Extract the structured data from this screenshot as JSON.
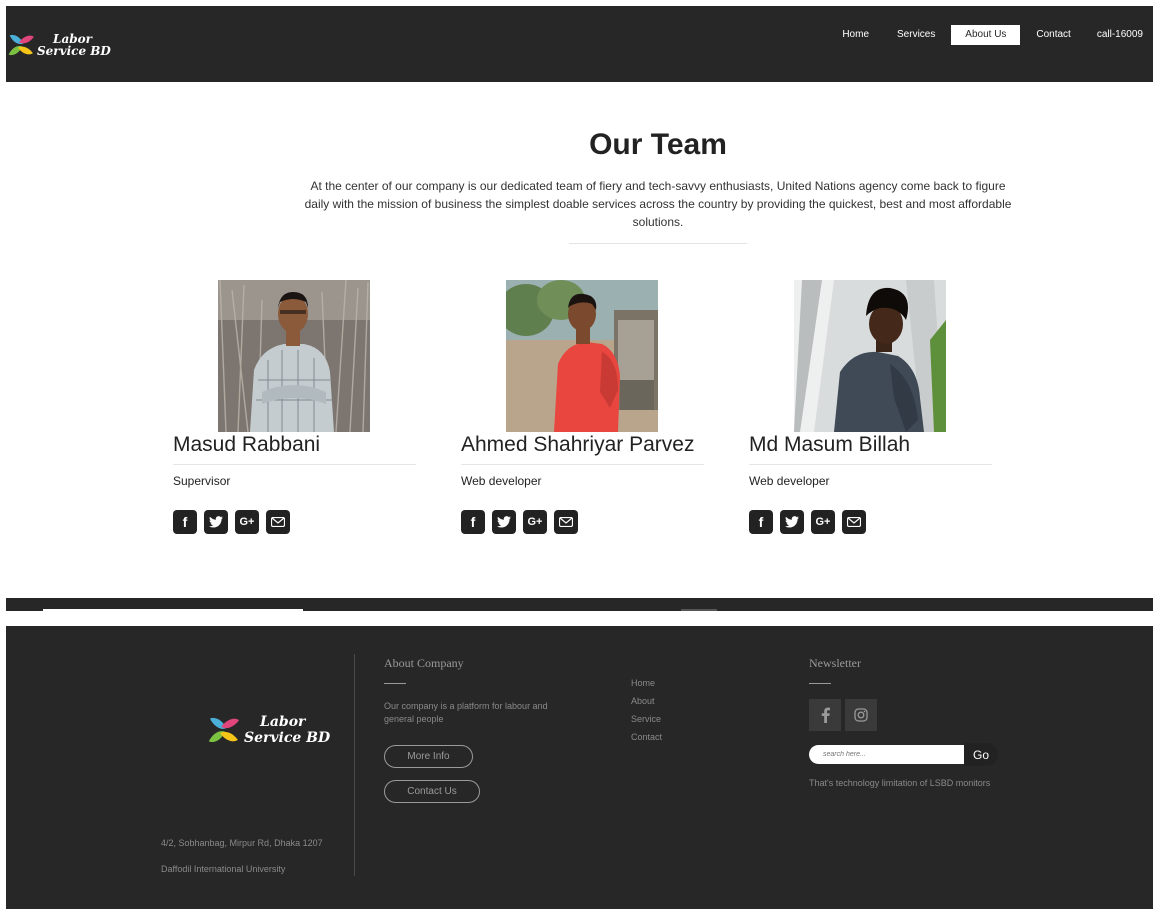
{
  "nav": {
    "logo_line1": "Labor",
    "logo_line2": "Service BD",
    "links": [
      "Home",
      "Services",
      "About Us",
      "Contact",
      "call-16009"
    ]
  },
  "team": {
    "title": "Our Team",
    "description": "At the center of our company is our dedicated team of fiery and tech-savvy enthusiasts, United Nations agency come back to figure daily with the mission of business the simplest doable services across the country by providing the quickest, best and most affordable solutions.",
    "members": [
      {
        "name": "Masud Rabbani",
        "role": "Supervisor"
      },
      {
        "name": "Ahmed Shahriyar Parvez",
        "role": "Web developer"
      },
      {
        "name": "Md Masum Billah",
        "role": "Web developer"
      }
    ]
  },
  "footer": {
    "logo_line1": "Labor",
    "logo_line2": "Service BD",
    "address": "4/2, Sobhanbag, Mirpur Rd, Dhaka 1207",
    "university": "Daffodil International University",
    "about_heading": "About Company",
    "about_text": "Our company is a platform for labour and general people",
    "more_info_label": "More Info",
    "contact_us_label": "Contact Us",
    "links": [
      "Home",
      "About",
      "Service",
      "Contact"
    ],
    "newsletter_heading": "Newsletter",
    "search_placeholder": "search here...",
    "go_label": "Go",
    "newsletter_note": "That's technology limitation of LSBD monitors"
  },
  "colors": {
    "dark": "#272727",
    "white": "#ffffff"
  }
}
